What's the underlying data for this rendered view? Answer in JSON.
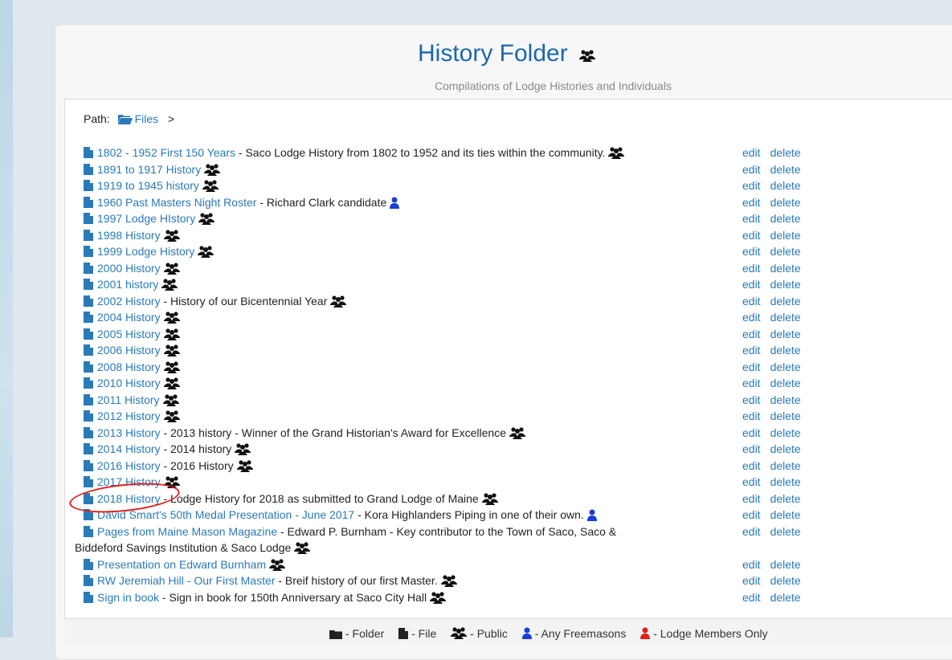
{
  "header": {
    "title": "History Folder",
    "subtitle": "Compilations of Lodge Histories and Individuals"
  },
  "path": {
    "label": "Path:",
    "folder": "Files",
    "separator": ">"
  },
  "actions": {
    "edit": "edit",
    "delete": "delete"
  },
  "files": [
    {
      "name": "1802 - 1952 First 150 Years",
      "desc": " - Saco Lodge History from 1802 to 1952 and its ties within the community.",
      "audience": "public"
    },
    {
      "name": "1891 to 1917 History",
      "desc": "",
      "audience": "public"
    },
    {
      "name": "1919 to 1945 history",
      "desc": "",
      "audience": "public"
    },
    {
      "name": "1960 Past Masters Night Roster",
      "desc": " - Richard Clark candidate",
      "audience": "freemasons"
    },
    {
      "name": "1997 Lodge HIstory",
      "desc": "",
      "audience": "public"
    },
    {
      "name": "1998 History",
      "desc": "",
      "audience": "public"
    },
    {
      "name": "1999 Lodge History",
      "desc": "",
      "audience": "public"
    },
    {
      "name": "2000 History",
      "desc": "",
      "audience": "public"
    },
    {
      "name": "2001 history",
      "desc": "",
      "audience": "public"
    },
    {
      "name": "2002 History",
      "desc": " - History of our Bicentennial Year",
      "audience": "public"
    },
    {
      "name": "2004 History",
      "desc": "",
      "audience": "public"
    },
    {
      "name": "2005 History",
      "desc": "",
      "audience": "public"
    },
    {
      "name": "2006 History",
      "desc": "",
      "audience": "public"
    },
    {
      "name": "2008 History",
      "desc": "",
      "audience": "public"
    },
    {
      "name": "2010 History",
      "desc": "",
      "audience": "public"
    },
    {
      "name": "2011 History",
      "desc": "",
      "audience": "public"
    },
    {
      "name": "2012 History",
      "desc": "",
      "audience": "public"
    },
    {
      "name": "2013 History",
      "desc": " - 2013 history - Winner of the Grand Historian's Award for Excellence",
      "audience": "public"
    },
    {
      "name": "2014 History",
      "desc": " - 2014 history",
      "audience": "public"
    },
    {
      "name": "2016 History",
      "desc": " - 2016 History",
      "audience": "public"
    },
    {
      "name": "2017 History",
      "desc": "",
      "audience": "public"
    },
    {
      "name": "2018 History",
      "desc": " - Lodge History for 2018 as submitted to Grand Lodge of Maine",
      "audience": "public"
    },
    {
      "name": "David Smart's 50th Medal Presentation - June 2017",
      "desc": " - Kora Highlanders Piping in one of their own.",
      "audience": "freemasons"
    },
    {
      "name": "Pages from Maine Mason Magazine",
      "desc": " - Edward P. Burnham - Key contributor to the Town of Saco, Saco &",
      "desc2": "Biddeford Savings Institution & Saco Lodge",
      "audience": "public"
    },
    {
      "name": "Presentation on Edward Burnham",
      "desc": "",
      "audience": "public"
    },
    {
      "name": "RW Jeremiah Hill - Our First Master",
      "desc": " - Breif history of our first Master.",
      "audience": "public"
    },
    {
      "name": "Sign in book",
      "desc": " - Sign in book for 150th Anniversary at Saco City Hall",
      "audience": "public"
    }
  ],
  "legend": {
    "folder": "- Folder",
    "file": "- File",
    "public": "- Public",
    "freemasons": "- Any Freemasons",
    "members": "- Lodge Members Only"
  },
  "colors": {
    "link": "#2a7ab8",
    "title": "#1c68a8",
    "freemasons_icon": "#1a3fd6",
    "members_icon": "#e0201c",
    "annotation": "#e0201c"
  }
}
